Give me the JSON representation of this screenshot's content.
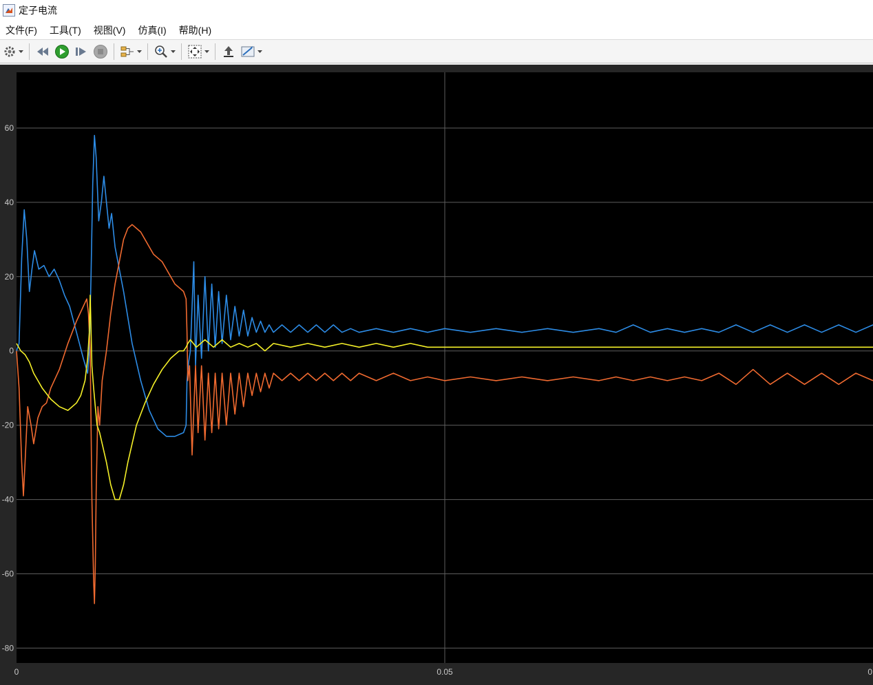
{
  "window": {
    "title": "定子电流"
  },
  "menu": [
    {
      "name": "menu-file",
      "label": "文件(F)"
    },
    {
      "name": "menu-tools",
      "label": "工具(T)"
    },
    {
      "name": "menu-view",
      "label": "视图(V)"
    },
    {
      "name": "menu-simulation",
      "label": "仿真(I)"
    },
    {
      "name": "menu-help",
      "label": "帮助(H)"
    }
  ],
  "toolbar": {
    "icons": [
      "settings-icon",
      "step-back-icon",
      "run-icon",
      "step-forward-icon",
      "stop-icon",
      "signal-selector-icon",
      "zoom-in-icon",
      "fit-to-view-icon",
      "restore-layout-icon",
      "measure-icon"
    ]
  },
  "colors": {
    "plot_background": "#000000",
    "frame": "#262626",
    "grid": "#5e5e5e",
    "tick_text": "#c8c8c8"
  },
  "chart_data": {
    "type": "line",
    "title": "",
    "xlabel": "",
    "ylabel": "",
    "xlim": [
      0,
      0.1
    ],
    "ylim": [
      -84,
      75
    ],
    "xticks": [
      0,
      0.05,
      0.1
    ],
    "xtick_labels": [
      "0",
      "0.05",
      "0"
    ],
    "yticks": [
      60,
      40,
      20,
      0,
      -20,
      -40,
      -60,
      -80
    ],
    "ytick_labels": [
      "60",
      "40",
      "20",
      "0",
      "-20",
      "-40",
      "-60",
      "-80"
    ],
    "grid": true,
    "legend": "none",
    "series": [
      {
        "color": "#2d8ce6",
        "points": [
          [
            0,
            0
          ],
          [
            0.0003,
            2
          ],
          [
            0.0006,
            25
          ],
          [
            0.0009,
            38
          ],
          [
            0.0012,
            30
          ],
          [
            0.0015,
            16
          ],
          [
            0.0018,
            22
          ],
          [
            0.0021,
            27
          ],
          [
            0.0026,
            22
          ],
          [
            0.0032,
            23
          ],
          [
            0.0038,
            20
          ],
          [
            0.0044,
            22
          ],
          [
            0.005,
            19
          ],
          [
            0.0056,
            15
          ],
          [
            0.0062,
            12
          ],
          [
            0.007,
            5
          ],
          [
            0.0078,
            -2
          ],
          [
            0.0083,
            -6
          ],
          [
            0.0085,
            0
          ],
          [
            0.0087,
            20
          ],
          [
            0.0089,
            45
          ],
          [
            0.0091,
            58
          ],
          [
            0.0093,
            52
          ],
          [
            0.0096,
            35
          ],
          [
            0.0099,
            40
          ],
          [
            0.0102,
            47
          ],
          [
            0.0105,
            40
          ],
          [
            0.0108,
            33
          ],
          [
            0.0111,
            37
          ],
          [
            0.0115,
            28
          ],
          [
            0.0125,
            16
          ],
          [
            0.0135,
            2
          ],
          [
            0.0145,
            -8
          ],
          [
            0.0155,
            -16
          ],
          [
            0.0165,
            -21
          ],
          [
            0.0175,
            -23
          ],
          [
            0.0185,
            -23
          ],
          [
            0.0195,
            -22
          ],
          [
            0.0198,
            -20
          ],
          [
            0.0199,
            -8
          ],
          [
            0.0201,
            -3
          ],
          [
            0.0203,
            0
          ],
          [
            0.0207,
            24
          ],
          [
            0.0209,
            -4
          ],
          [
            0.0212,
            15
          ],
          [
            0.0216,
            -2
          ],
          [
            0.022,
            20
          ],
          [
            0.0224,
            0
          ],
          [
            0.0228,
            18
          ],
          [
            0.0232,
            1
          ],
          [
            0.0236,
            16
          ],
          [
            0.024,
            2
          ],
          [
            0.0245,
            15
          ],
          [
            0.025,
            3
          ],
          [
            0.0255,
            12
          ],
          [
            0.026,
            4
          ],
          [
            0.0265,
            11
          ],
          [
            0.027,
            4
          ],
          [
            0.0275,
            9
          ],
          [
            0.028,
            5
          ],
          [
            0.0285,
            8
          ],
          [
            0.029,
            5
          ],
          [
            0.0295,
            7
          ],
          [
            0.03,
            5
          ],
          [
            0.031,
            7
          ],
          [
            0.032,
            5
          ],
          [
            0.033,
            7
          ],
          [
            0.034,
            5
          ],
          [
            0.035,
            7
          ],
          [
            0.036,
            5
          ],
          [
            0.037,
            7
          ],
          [
            0.038,
            5
          ],
          [
            0.039,
            6
          ],
          [
            0.04,
            5
          ],
          [
            0.042,
            6
          ],
          [
            0.044,
            5
          ],
          [
            0.046,
            6
          ],
          [
            0.048,
            5
          ],
          [
            0.05,
            6
          ],
          [
            0.053,
            5
          ],
          [
            0.056,
            6
          ],
          [
            0.059,
            5
          ],
          [
            0.062,
            6
          ],
          [
            0.065,
            5
          ],
          [
            0.068,
            6
          ],
          [
            0.07,
            5
          ],
          [
            0.072,
            7
          ],
          [
            0.074,
            5
          ],
          [
            0.076,
            6
          ],
          [
            0.078,
            5
          ],
          [
            0.08,
            6
          ],
          [
            0.082,
            5
          ],
          [
            0.084,
            7
          ],
          [
            0.086,
            5
          ],
          [
            0.088,
            7
          ],
          [
            0.09,
            5
          ],
          [
            0.092,
            7
          ],
          [
            0.094,
            5
          ],
          [
            0.096,
            7
          ],
          [
            0.098,
            5
          ],
          [
            0.1,
            7
          ]
        ]
      },
      {
        "color": "#f06a30",
        "points": [
          [
            0,
            0
          ],
          [
            0.0003,
            -10
          ],
          [
            0.0006,
            -30
          ],
          [
            0.0008,
            -39
          ],
          [
            0.001,
            -30
          ],
          [
            0.0013,
            -15
          ],
          [
            0.0017,
            -20
          ],
          [
            0.002,
            -25
          ],
          [
            0.0025,
            -18
          ],
          [
            0.003,
            -15
          ],
          [
            0.0035,
            -14
          ],
          [
            0.004,
            -10
          ],
          [
            0.005,
            -5
          ],
          [
            0.006,
            2
          ],
          [
            0.007,
            8
          ],
          [
            0.0078,
            12
          ],
          [
            0.0082,
            14
          ],
          [
            0.0084,
            10
          ],
          [
            0.0086,
            0
          ],
          [
            0.0088,
            -40
          ],
          [
            0.009,
            -62
          ],
          [
            0.0091,
            -68
          ],
          [
            0.0092,
            -58
          ],
          [
            0.0093,
            -38
          ],
          [
            0.0095,
            -15
          ],
          [
            0.0097,
            -20
          ],
          [
            0.01,
            -8
          ],
          [
            0.0105,
            0
          ],
          [
            0.011,
            10
          ],
          [
            0.0115,
            18
          ],
          [
            0.012,
            24
          ],
          [
            0.0125,
            30
          ],
          [
            0.013,
            33
          ],
          [
            0.0135,
            34
          ],
          [
            0.014,
            33
          ],
          [
            0.0145,
            32
          ],
          [
            0.015,
            30
          ],
          [
            0.0155,
            28
          ],
          [
            0.016,
            26
          ],
          [
            0.0165,
            25
          ],
          [
            0.017,
            24
          ],
          [
            0.0175,
            22
          ],
          [
            0.018,
            20
          ],
          [
            0.0185,
            18
          ],
          [
            0.019,
            17
          ],
          [
            0.0195,
            16
          ],
          [
            0.0198,
            14
          ],
          [
            0.0199,
            5
          ],
          [
            0.02,
            -8
          ],
          [
            0.0202,
            -4
          ],
          [
            0.0205,
            -28
          ],
          [
            0.0209,
            -4
          ],
          [
            0.0212,
            -22
          ],
          [
            0.0216,
            -4
          ],
          [
            0.022,
            -24
          ],
          [
            0.0224,
            -6
          ],
          [
            0.0228,
            -22
          ],
          [
            0.0232,
            -6
          ],
          [
            0.0236,
            -21
          ],
          [
            0.024,
            -6
          ],
          [
            0.0245,
            -20
          ],
          [
            0.025,
            -6
          ],
          [
            0.0255,
            -17
          ],
          [
            0.026,
            -6
          ],
          [
            0.0265,
            -15
          ],
          [
            0.027,
            -6
          ],
          [
            0.0275,
            -12
          ],
          [
            0.028,
            -6
          ],
          [
            0.0285,
            -11
          ],
          [
            0.029,
            -6
          ],
          [
            0.0295,
            -10
          ],
          [
            0.03,
            -6
          ],
          [
            0.031,
            -8
          ],
          [
            0.032,
            -6
          ],
          [
            0.033,
            -8
          ],
          [
            0.034,
            -6
          ],
          [
            0.035,
            -8
          ],
          [
            0.036,
            -6
          ],
          [
            0.037,
            -8
          ],
          [
            0.038,
            -6
          ],
          [
            0.039,
            -8
          ],
          [
            0.04,
            -6
          ],
          [
            0.042,
            -8
          ],
          [
            0.044,
            -6
          ],
          [
            0.046,
            -8
          ],
          [
            0.048,
            -7
          ],
          [
            0.05,
            -8
          ],
          [
            0.053,
            -7
          ],
          [
            0.056,
            -8
          ],
          [
            0.059,
            -7
          ],
          [
            0.062,
            -8
          ],
          [
            0.065,
            -7
          ],
          [
            0.068,
            -8
          ],
          [
            0.07,
            -7
          ],
          [
            0.072,
            -8
          ],
          [
            0.074,
            -7
          ],
          [
            0.076,
            -8
          ],
          [
            0.078,
            -7
          ],
          [
            0.08,
            -8
          ],
          [
            0.082,
            -6
          ],
          [
            0.084,
            -9
          ],
          [
            0.086,
            -5
          ],
          [
            0.088,
            -9
          ],
          [
            0.09,
            -6
          ],
          [
            0.092,
            -9
          ],
          [
            0.094,
            -6
          ],
          [
            0.096,
            -9
          ],
          [
            0.098,
            -6
          ],
          [
            0.1,
            -8
          ]
        ]
      },
      {
        "color": "#f5f028",
        "points": [
          [
            0,
            2
          ],
          [
            0.0005,
            0
          ],
          [
            0.001,
            -1
          ],
          [
            0.0015,
            -3
          ],
          [
            0.002,
            -6
          ],
          [
            0.0025,
            -8
          ],
          [
            0.003,
            -10
          ],
          [
            0.004,
            -13
          ],
          [
            0.005,
            -15
          ],
          [
            0.006,
            -16
          ],
          [
            0.007,
            -14
          ],
          [
            0.0075,
            -12
          ],
          [
            0.008,
            -8
          ],
          [
            0.0083,
            -2
          ],
          [
            0.0085,
            5
          ],
          [
            0.0086,
            15
          ],
          [
            0.0087,
            6
          ],
          [
            0.0088,
            -4
          ],
          [
            0.009,
            -10
          ],
          [
            0.0092,
            -15
          ],
          [
            0.0094,
            -20
          ],
          [
            0.0097,
            -22
          ],
          [
            0.01,
            -25
          ],
          [
            0.0105,
            -30
          ],
          [
            0.011,
            -36
          ],
          [
            0.0115,
            -40
          ],
          [
            0.012,
            -40
          ],
          [
            0.0125,
            -36
          ],
          [
            0.013,
            -30
          ],
          [
            0.0135,
            -25
          ],
          [
            0.014,
            -20
          ],
          [
            0.015,
            -14
          ],
          [
            0.016,
            -9
          ],
          [
            0.017,
            -5
          ],
          [
            0.018,
            -2
          ],
          [
            0.019,
            0
          ],
          [
            0.0195,
            0
          ],
          [
            0.0198,
            1
          ],
          [
            0.02,
            2
          ],
          [
            0.0203,
            3
          ],
          [
            0.021,
            1
          ],
          [
            0.022,
            3
          ],
          [
            0.023,
            1
          ],
          [
            0.024,
            3
          ],
          [
            0.025,
            1
          ],
          [
            0.026,
            2
          ],
          [
            0.027,
            1
          ],
          [
            0.028,
            2
          ],
          [
            0.029,
            0
          ],
          [
            0.03,
            2
          ],
          [
            0.032,
            1
          ],
          [
            0.034,
            2
          ],
          [
            0.036,
            1
          ],
          [
            0.038,
            2
          ],
          [
            0.04,
            1
          ],
          [
            0.042,
            2
          ],
          [
            0.044,
            1
          ],
          [
            0.046,
            2
          ],
          [
            0.048,
            1
          ],
          [
            0.05,
            1
          ],
          [
            0.055,
            1
          ],
          [
            0.06,
            1
          ],
          [
            0.065,
            1
          ],
          [
            0.07,
            1
          ],
          [
            0.075,
            1
          ],
          [
            0.08,
            1
          ],
          [
            0.085,
            1
          ],
          [
            0.09,
            1
          ],
          [
            0.095,
            1
          ],
          [
            0.1,
            1
          ]
        ]
      }
    ]
  }
}
